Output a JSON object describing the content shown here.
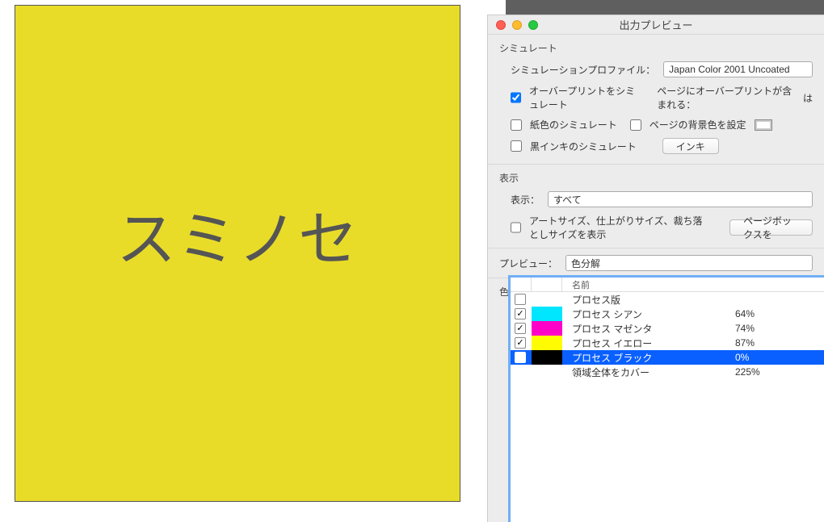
{
  "document": {
    "text": "スミノセ"
  },
  "panel": {
    "title": "出力プレビュー",
    "simulate": {
      "title": "シミュレート",
      "profile_label": "シミュレーションプロファイル：",
      "profile_value": "Japan Color 2001 Uncoated",
      "overprint_label": "オーバープリントをシミュレート",
      "page_overprint_label": "ページにオーバープリントが含まれる：",
      "page_overprint_value": "は",
      "paper_label": "紙色のシミュレート",
      "bg_label": "ページの背景色を設定",
      "black_ink_label": "黒インキのシミュレート",
      "ink_button": "インキ"
    },
    "display": {
      "title": "表示",
      "show_label": "表示：",
      "show_value": "すべて",
      "sizes_label": "アートサイズ、仕上がりサイズ、裁ち落としサイズを表示",
      "page_box_button": "ページボックスを"
    },
    "preview": {
      "label": "プレビュー：",
      "value": "色分解"
    },
    "separations": {
      "title": "色分解",
      "name_header": "名前",
      "rows": [
        {
          "name": "プロセス版",
          "pct": "",
          "group": true
        },
        {
          "name": "プロセス シアン",
          "pct": "64%",
          "color": "#00E6FF",
          "checked": true
        },
        {
          "name": "プロセス マゼンタ",
          "pct": "74%",
          "color": "#FF00C8",
          "checked": true
        },
        {
          "name": "プロセス イエロー",
          "pct": "87%",
          "color": "#FFFB00",
          "checked": true
        },
        {
          "name": "プロセス ブラック",
          "pct": "0%",
          "color": "#000000",
          "checked": false,
          "selected": true
        },
        {
          "name": "領域全体をカバー",
          "pct": "225%"
        }
      ]
    }
  }
}
